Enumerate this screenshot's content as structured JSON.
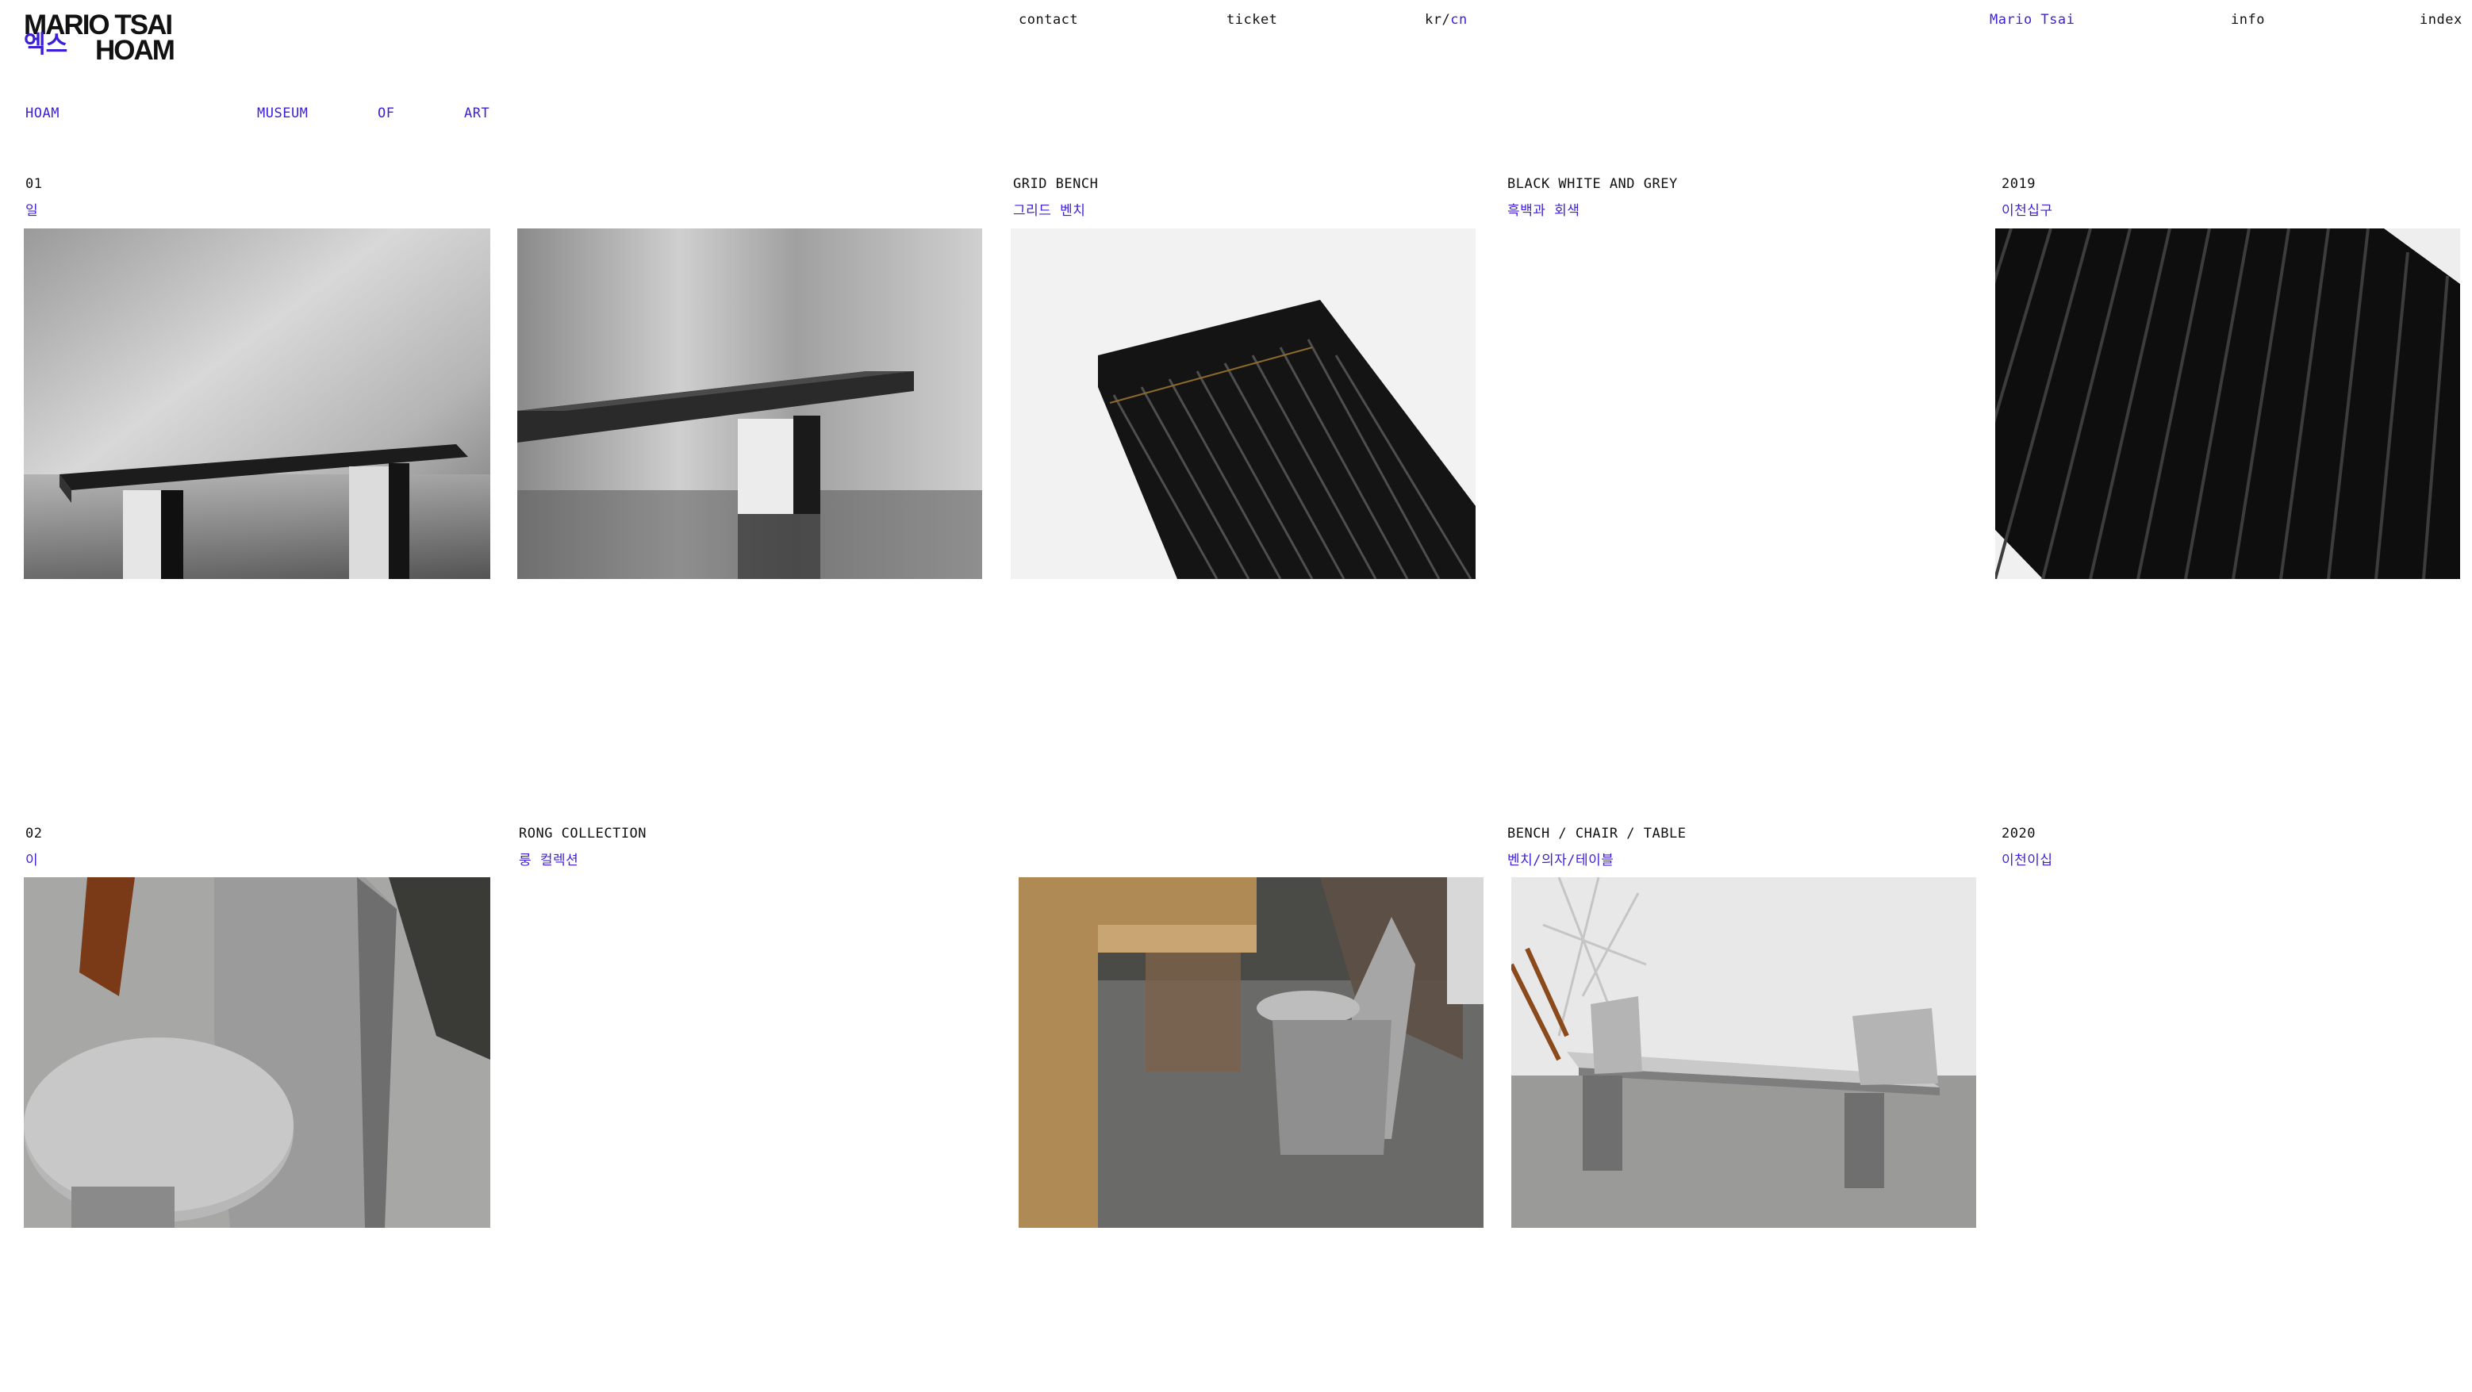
{
  "logo": {
    "line1": "MARIO TSAI",
    "line2_ko": "엑스",
    "line2": "HOAM"
  },
  "nav": {
    "contact": "contact",
    "ticket": "ticket",
    "lang_kr": "kr/",
    "lang_cn": "cn",
    "designer": "Mario Tsai",
    "info": "info",
    "index": "index"
  },
  "museum": {
    "word1": "HOAM",
    "word2": "MUSEUM",
    "word3": "OF",
    "word4": "ART"
  },
  "projects": [
    {
      "number": "01",
      "number_ko": "일",
      "title": "GRID BENCH",
      "title_ko": "그리드 벤치",
      "material": "BLACK WHITE AND GREY",
      "material_ko": "흑백과 회색",
      "year": "2019",
      "year_ko": "이천십구",
      "images": [
        "grid-bench-side-view",
        "grid-bench-angled-view",
        "grid-bench-top-detail",
        "grid-bench-slats-closeup"
      ]
    },
    {
      "number": "02",
      "number_ko": "이",
      "title": "RONG COLLECTION",
      "title_ko": "룽 컬렉션",
      "material": "BENCH / CHAIR / TABLE",
      "material_ko": "벤치/의자/테이블",
      "year": "2020",
      "year_ko": "이천이십",
      "images": [
        "rong-chair-table-closeup",
        "rong-chair-in-room",
        "rong-bench-and-chairs"
      ]
    }
  ],
  "colors": {
    "accent": "#3b1fd8",
    "text": "#111111",
    "background": "#ffffff"
  }
}
